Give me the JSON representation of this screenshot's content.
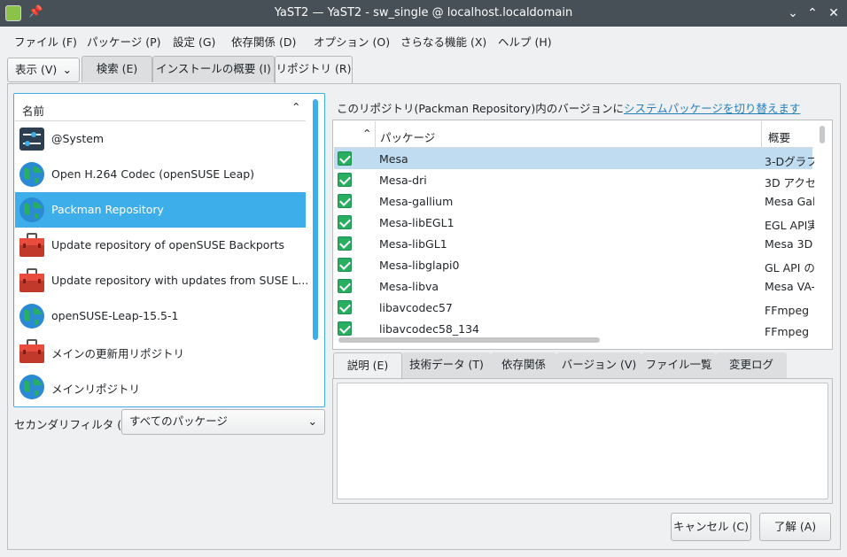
{
  "window": {
    "title": "YaST2 — YaST2 - sw_single @ localhost.localdomain"
  },
  "menu": [
    "ファイル (F)",
    "パッケージ (P)",
    "設定 (G)",
    "依存関係 (D)",
    "オプション (O)",
    "さらなる機能 (X)",
    "ヘルプ (H)"
  ],
  "view_combo": "表示 (V)",
  "tabs": {
    "search": "検索 (E)",
    "install_summary": "インストールの概要 (I)",
    "repositories": "リポジトリ (R)"
  },
  "repo_list": {
    "header": "名前",
    "items": [
      {
        "label": "@System",
        "icon": "system-settings-icon"
      },
      {
        "label": "Open H.264 Codec (openSUSE Leap)",
        "icon": "globe-icon"
      },
      {
        "label": "Packman Repository",
        "icon": "globe-icon",
        "selected": true
      },
      {
        "label": "Update repository of openSUSE Backports",
        "icon": "toolbox-icon"
      },
      {
        "label": "Update repository with updates from SUSE L...",
        "icon": "toolbox-icon"
      },
      {
        "label": "openSUSE-Leap-15.5-1",
        "icon": "globe-icon"
      },
      {
        "label": "メインの更新用リポジトリ",
        "icon": "toolbox-icon"
      },
      {
        "label": "メインリポジトリ",
        "icon": "globe-icon"
      }
    ]
  },
  "secondary_filter": {
    "label": "セカンダリフィルタ (S):",
    "value": "すべてのパッケージ"
  },
  "switch_notice": {
    "prefix": "このリポジトリ(Packman Repository)内のバージョンに",
    "link": "システムパッケージを切り替えます"
  },
  "package_table": {
    "headers": {
      "package": "パッケージ",
      "summary": "概要"
    },
    "rows": [
      {
        "name": "Mesa",
        "summary": "3-Dグラフ",
        "selected": true
      },
      {
        "name": "Mesa-dri",
        "summary": "3D アクセ"
      },
      {
        "name": "Mesa-gallium",
        "summary": "Mesa Gal"
      },
      {
        "name": "Mesa-libEGL1",
        "summary": "EGL API実"
      },
      {
        "name": "Mesa-libGL1",
        "summary": "Mesa 3D"
      },
      {
        "name": "Mesa-libglapi0",
        "summary": "GL API の"
      },
      {
        "name": "Mesa-libva",
        "summary": "Mesa VA-"
      },
      {
        "name": "libavcodec57",
        "summary": "FFmpeg コ"
      },
      {
        "name": "libavcodec58_134",
        "summary": "FFmpeg コ"
      }
    ]
  },
  "detail_tabs": [
    "説明 (E)",
    "技術データ (T)",
    "依存関係",
    "バージョン (V)",
    "ファイル一覧",
    "変更ログ"
  ],
  "buttons": {
    "cancel": "キャンセル (C)",
    "ok": "了解 (A)"
  },
  "colors": {
    "selection": "#3daee9",
    "checkbox": "#27ae60",
    "titlebar": "#475057",
    "link": "#2980b9"
  }
}
